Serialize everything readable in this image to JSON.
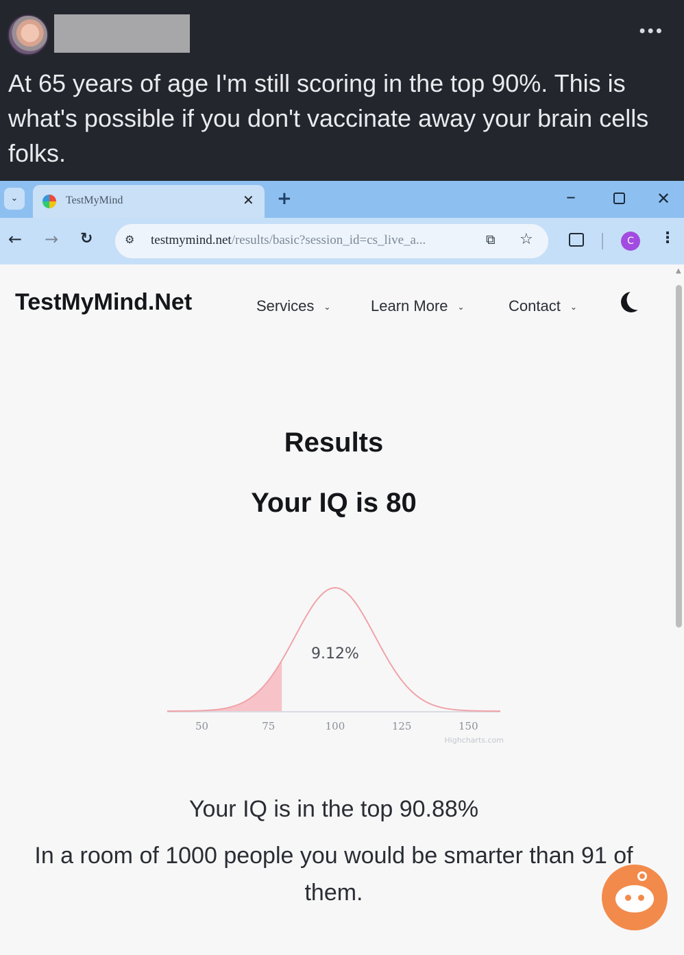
{
  "post": {
    "text": "At 65 years of age I'm still scoring in the top 90%. This is what's possible if you don't vaccinate away your brain cells folks.",
    "more_icon": "•••"
  },
  "browser": {
    "tab_title": "TestMyMind",
    "tab_close": "✕",
    "new_tab": "+",
    "url_host": "testmymind.net",
    "url_path": "/results/basic?session_id=cs_live_a...",
    "profile_initial": "C",
    "tab_menu": "⌄",
    "back": "←",
    "forward": "→",
    "reload": "↻",
    "minimize": "–",
    "close_window": "✕",
    "site_info": "⚙",
    "cast": "⧉",
    "star": "☆",
    "kebab": "⋮"
  },
  "site": {
    "brand": "TestMyMind.Net",
    "nav": [
      "Services",
      "Learn More",
      "Contact"
    ],
    "nav_chevron": "⌄",
    "results_heading": "Results",
    "iq_heading": "Your IQ is 80",
    "summary_line": "Your IQ is in the top 90.88%",
    "room_line": "In a room of 1000 people you would be smarter than 91 of them."
  },
  "chart_data": {
    "type": "area",
    "distribution": "normal",
    "mean": 100,
    "sd": 15,
    "x_ticks": [
      50,
      75,
      100,
      125,
      150
    ],
    "xlim": [
      37,
      162
    ],
    "shaded_upto": 80,
    "shaded_label": "9.12%",
    "credit": "Highcharts.com",
    "colors": {
      "line": "#f0a3a8",
      "fill": "#f7c3c8",
      "axis": "#d9dbe0",
      "tick": "#8a8f96"
    }
  }
}
